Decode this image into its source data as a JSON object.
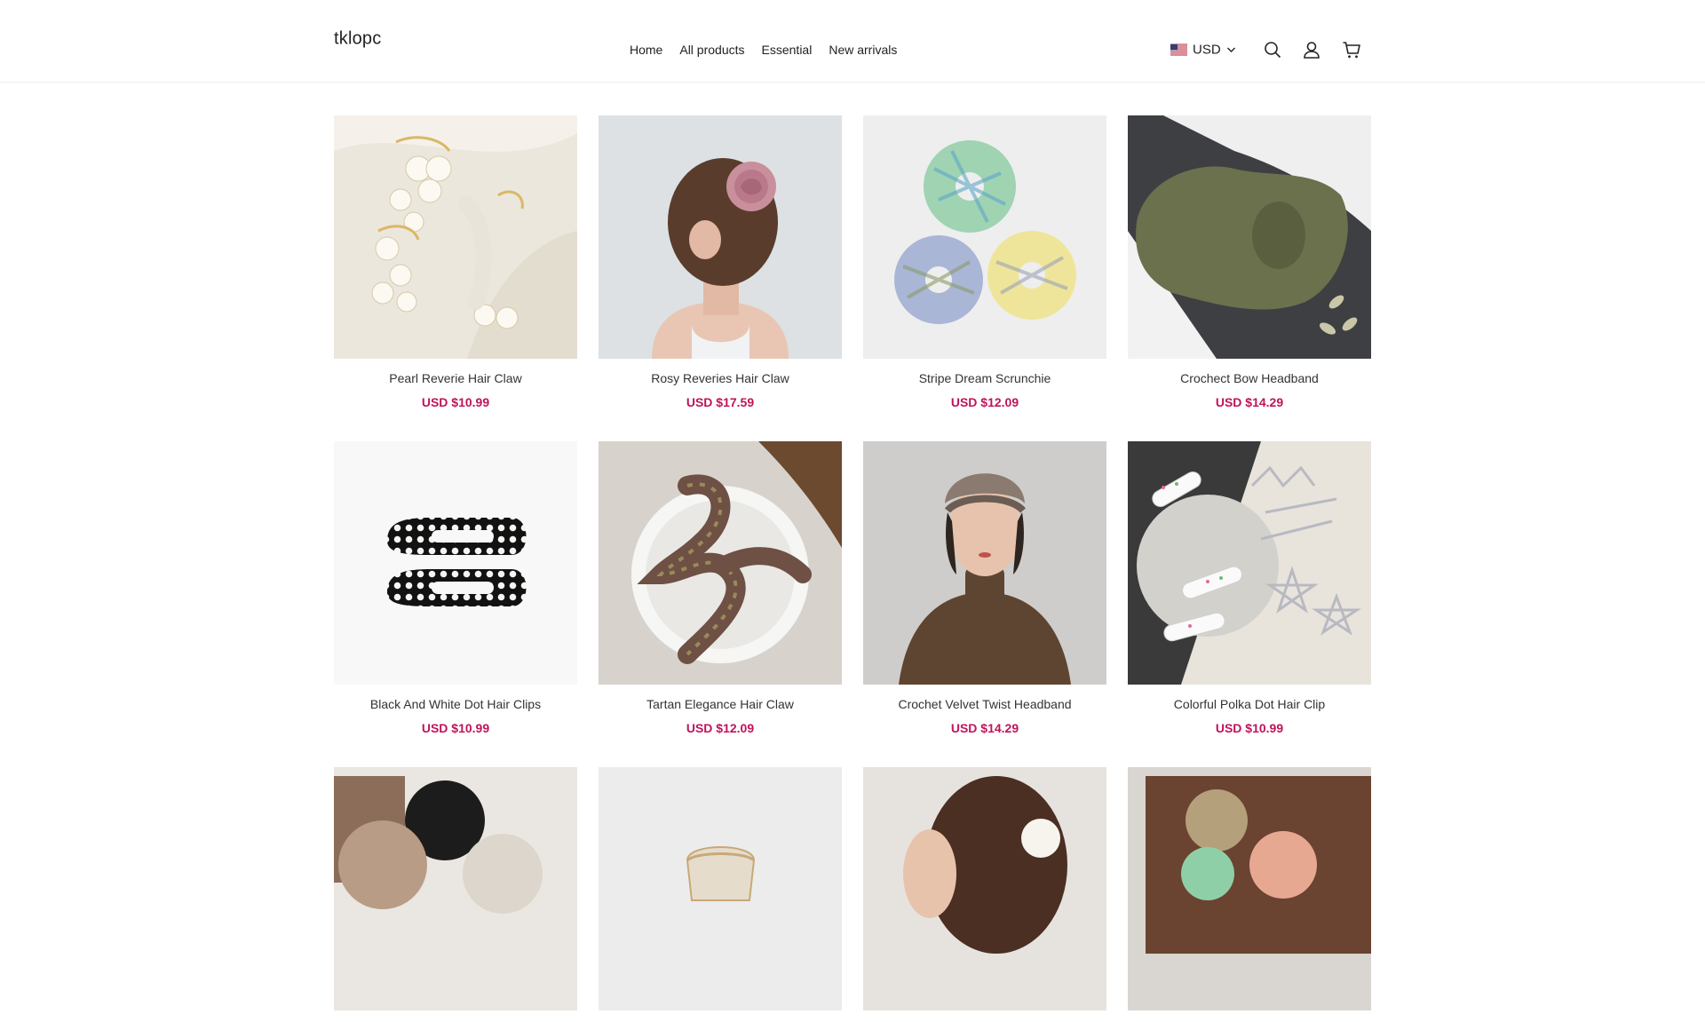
{
  "brand": {
    "name": "tklopc"
  },
  "theme": {
    "price_color": "#c0135a",
    "text_color": "#222222",
    "border_color": "#ececec"
  },
  "nav": {
    "items": [
      {
        "label": "Home"
      },
      {
        "label": "All products"
      },
      {
        "label": "Essential"
      },
      {
        "label": "New arrivals"
      }
    ]
  },
  "header": {
    "currency": "USD",
    "icons": [
      "us-flag-icon",
      "chevron-down-icon",
      "search-icon",
      "account-icon",
      "cart-icon"
    ]
  },
  "products": [
    {
      "title": "Pearl Reverie Hair Claw",
      "price": "USD $10.99"
    },
    {
      "title": "Rosy Reveries Hair Claw",
      "price": "USD $17.59"
    },
    {
      "title": "Stripe Dream Scrunchie",
      "price": "USD $12.09"
    },
    {
      "title": "Crochect Bow Headband",
      "price": "USD $14.29"
    },
    {
      "title": "Black And White Dot Hair Clips",
      "price": "USD $10.99"
    },
    {
      "title": "Tartan Elegance Hair Claw",
      "price": "USD $12.09"
    },
    {
      "title": "Crochet Velvet Twist Headband",
      "price": "USD $14.29"
    },
    {
      "title": "Colorful Polka Dot Hair Clip",
      "price": "USD $10.99"
    },
    {
      "title": "",
      "price": ""
    },
    {
      "title": "",
      "price": ""
    },
    {
      "title": "",
      "price": ""
    },
    {
      "title": "",
      "price": ""
    }
  ]
}
